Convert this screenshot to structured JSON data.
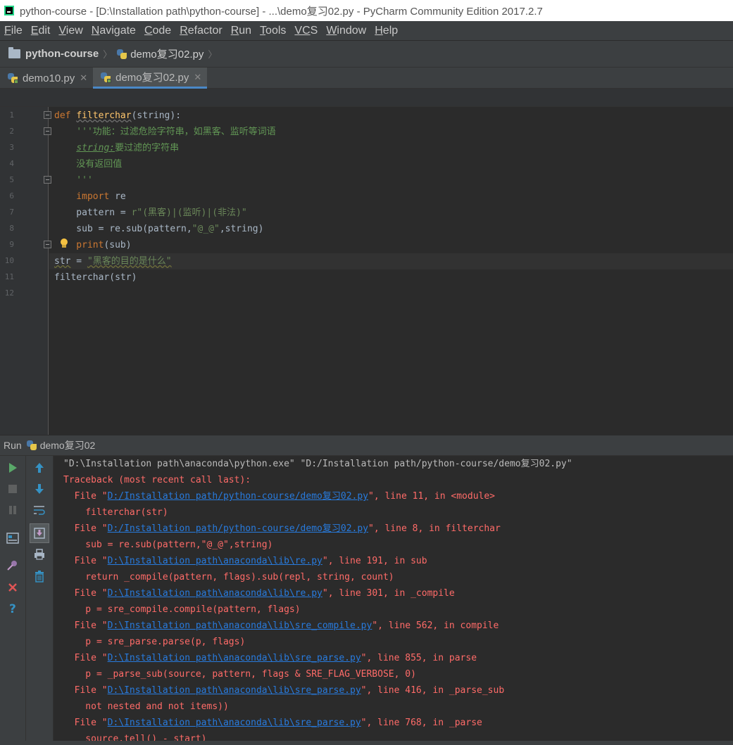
{
  "window": {
    "title": "python-course - [D:\\Installation path\\python-course] - ...\\demo复习02.py - PyCharm Community Edition 2017.2.7"
  },
  "menu": [
    {
      "mn": "F",
      "rest": "ile"
    },
    {
      "mn": "E",
      "rest": "dit"
    },
    {
      "mn": "V",
      "rest": "iew"
    },
    {
      "mn": "N",
      "rest": "avigate"
    },
    {
      "mn": "C",
      "rest": "ode"
    },
    {
      "mn": "R",
      "rest": "efactor"
    },
    {
      "mn": "R",
      "rest": "un"
    },
    {
      "mn": "T",
      "rest": "ools"
    },
    {
      "mn": "VC",
      "rest": "S"
    },
    {
      "mn": "W",
      "rest": "indow"
    },
    {
      "mn": "H",
      "rest": "elp"
    }
  ],
  "breadcrumb": {
    "project": "python-course",
    "file": "demo复习02.py"
  },
  "tabs": [
    {
      "label": "demo10.py",
      "active": false
    },
    {
      "label": "demo复习02.py",
      "active": true
    }
  ],
  "editor": {
    "line_numbers": [
      "1",
      "2",
      "3",
      "4",
      "5",
      "6",
      "7",
      "8",
      "9",
      "10",
      "11",
      "12"
    ],
    "lines": {
      "l1_kw": "def ",
      "l1_fn": "filterchar",
      "l1_rest": "(string):",
      "l2_doc": "    '''功能：过滤危险字符串，如黑客、监听等词语",
      "l3_tag": "string:",
      "l3_rest": "要过滤的字符串",
      "l4_doc": "    没有返回值",
      "l5_doc": "    '''",
      "l6_kw": "    import",
      "l6_rest": " re",
      "l7_pre": "    pattern = ",
      "l7_str": "r\"(黑客)|(监听)|(非法)\"",
      "l8_pre": "    sub = re.sub(pattern,",
      "l8_str": "\"@_@\"",
      "l8_rest": ",string)",
      "l9_kw": "    print",
      "l9_rest": "(sub)",
      "l10_pre": "str",
      "l10_eq": " = ",
      "l10_str": "\"黑客的目的是什么\"",
      "l11": "filterchar(str)"
    }
  },
  "run": {
    "label": "Run",
    "config": "demo复习02",
    "console": {
      "cmd": "\"D:\\Installation path\\anaconda\\python.exe\" \"D:/Installation path/python-course/demo复习02.py\"",
      "traceback": "Traceback (most recent call last):",
      "f1_pre": "  File \"",
      "f1_link": "D:/Installation path/python-course/demo复习02.py",
      "f1_post": "\", line 11, in <module>",
      "c1": "    filterchar(str)",
      "f2_pre": "  File \"",
      "f2_link": "D:/Installation path/python-course/demo复习02.py",
      "f2_post": "\", line 8, in filterchar",
      "c2": "    sub = re.sub(pattern,\"@_@\",string)",
      "f3_pre": "  File \"",
      "f3_link": "D:\\Installation path\\anaconda\\lib\\re.py",
      "f3_post": "\", line 191, in sub",
      "c3": "    return _compile(pattern, flags).sub(repl, string, count)",
      "f4_pre": "  File \"",
      "f4_link": "D:\\Installation path\\anaconda\\lib\\re.py",
      "f4_post": "\", line 301, in _compile",
      "c4": "    p = sre_compile.compile(pattern, flags)",
      "f5_pre": "  File \"",
      "f5_link": "D:\\Installation path\\anaconda\\lib\\sre_compile.py",
      "f5_post": "\", line 562, in compile",
      "c5": "    p = sre_parse.parse(p, flags)",
      "f6_pre": "  File \"",
      "f6_link": "D:\\Installation path\\anaconda\\lib\\sre_parse.py",
      "f6_post": "\", line 855, in parse",
      "c6": "    p = _parse_sub(source, pattern, flags & SRE_FLAG_VERBOSE, 0)",
      "f7_pre": "  File \"",
      "f7_link": "D:\\Installation path\\anaconda\\lib\\sre_parse.py",
      "f7_post": "\", line 416, in _parse_sub",
      "c7": "    not nested and not items))",
      "f8_pre": "  File \"",
      "f8_link": "D:\\Installation path\\anaconda\\lib\\sre_parse.py",
      "f8_post": "\", line 768, in _parse",
      "c8": "    source.tell() - start)"
    }
  },
  "colors": {
    "editor_bg": "#2b2b2b",
    "keyword": "#cc7832",
    "function": "#ffc66d",
    "string": "#6a8759",
    "docstring": "#629755",
    "error_text": "#ff6b68",
    "link": "#287bde"
  }
}
